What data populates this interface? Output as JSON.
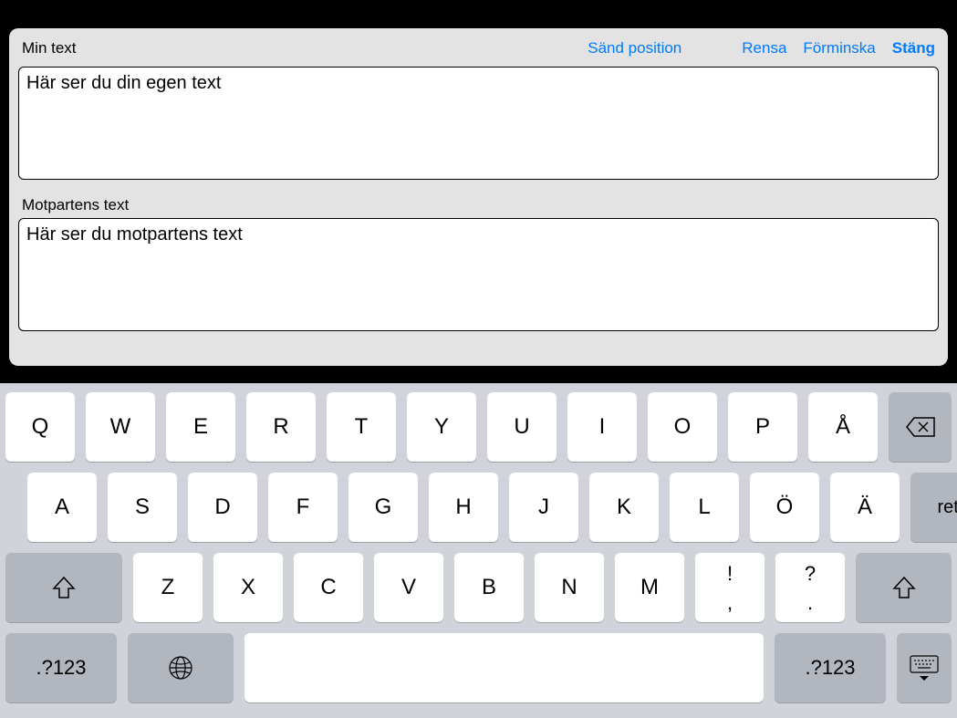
{
  "header": {
    "title": "Min text",
    "actions": {
      "send_position": "Sänd position",
      "clear": "Rensa",
      "minimize": "Förminska",
      "close": "Stäng"
    }
  },
  "my_text": {
    "label": "Min text",
    "value": "Här ser du din egen text"
  },
  "other_text": {
    "label": "Motpartens text",
    "value": "Här ser du motpartens text"
  },
  "keyboard": {
    "row1": [
      "Q",
      "W",
      "E",
      "R",
      "T",
      "Y",
      "U",
      "I",
      "O",
      "P",
      "Å"
    ],
    "row2": [
      "A",
      "S",
      "D",
      "F",
      "G",
      "H",
      "J",
      "K",
      "L",
      "Ö",
      "Ä"
    ],
    "row3": [
      "Z",
      "X",
      "C",
      "V",
      "B",
      "N",
      "M"
    ],
    "punct1_top": "!",
    "punct1_bottom": ",",
    "punct2_top": "?",
    "punct2_bottom": ".",
    "return": "retur",
    "mode": ".?123"
  }
}
